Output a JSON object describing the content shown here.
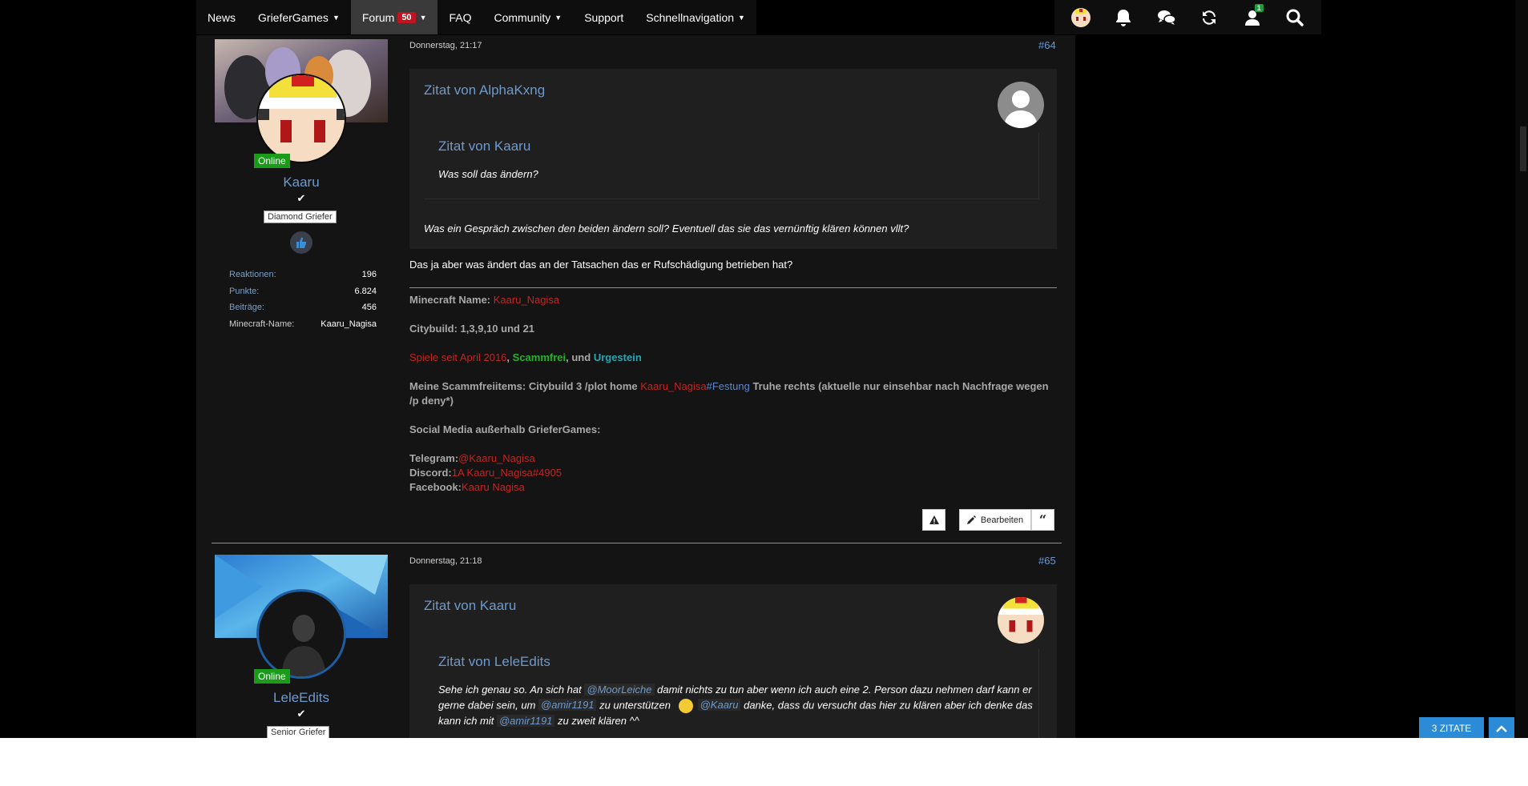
{
  "nav": {
    "items": [
      {
        "label": "News"
      },
      {
        "label": "GrieferGames"
      },
      {
        "label": "Forum",
        "badge": "50"
      },
      {
        "label": "FAQ"
      },
      {
        "label": "Community"
      },
      {
        "label": "Support"
      },
      {
        "label": "Schnellnavigation"
      }
    ],
    "icons": [
      "user-avatar-icon",
      "bell-icon",
      "chat-icon",
      "refresh-icon",
      "user-icon",
      "search-icon"
    ],
    "user_badge": "1"
  },
  "posts": [
    {
      "date": "Donnerstag, 21:17",
      "number": "#64",
      "user": {
        "status": "Online",
        "name": "Kaaru",
        "rank": "Diamond Griefer",
        "stats": [
          {
            "label": "Reaktionen:",
            "value": "196"
          },
          {
            "label": "Punkte:",
            "value": "6.824"
          },
          {
            "label": "Beiträge:",
            "value": "456"
          },
          {
            "label": "Minecraft-Name:",
            "value": "Kaaru_Nagisa"
          }
        ]
      },
      "quote": {
        "header": "Zitat von AlphaKxng",
        "inner_header": "Zitat von Kaaru",
        "inner_text": "Was soll das ändern?",
        "text": "Was ein Gespräch zwischen den beiden ändern soll? Eventuell das sie das vernünftig klären können vllt?"
      },
      "body": "Das ja aber was ändert das an der Tatsachen das er Rufschädigung betrieben hat?",
      "signature": {
        "mc_label": "Minecraft Name: ",
        "mc_value": "Kaaru_Nagisa",
        "citybuild": "Citybuild: 1,3,9,10 und 21",
        "since": "Spiele seit April 2016",
        "comma": ", ",
        "scammfrei": "Scammfrei",
        "und": ", und ",
        "urgestein": "Urgestein",
        "items_prefix": "Meine Scammfreiitems: Citybuild 3 /plot home ",
        "items_name": "Kaaru_Nagisa",
        "items_hash": "#Festung",
        "items_suffix": " Truhe rechts (aktuelle nur einsehbar nach Nachfrage wegen /p deny*)",
        "social": "Social Media außerhalb GrieferGames:",
        "telegram_label": "Telegram:",
        "telegram_value": "@Kaaru_Nagisa",
        "discord_label": "Discord:",
        "discord_value": "1A Kaaru_Nagisa#4905",
        "facebook_label": "Facebook:",
        "facebook_value": "Kaaru Nagisa"
      },
      "actions": {
        "edit": "Bearbeiten"
      }
    },
    {
      "date": "Donnerstag, 21:18",
      "number": "#65",
      "user": {
        "status": "Online",
        "name": "LeleEdits",
        "rank": "Senior Griefer"
      },
      "quote": {
        "header": "Zitat von Kaaru",
        "inner_header": "Zitat von LeleEdits",
        "line1_a": "Sehe ich genau so. An sich hat ",
        "mention1": "@MoorLeiche",
        "line1_b": " damit nichts zu tun aber wenn ich auch eine 2. Person dazu nehmen darf kann er",
        "line2_a": "gerne dabei sein, um ",
        "mention2": "@amir1191",
        "line2_b": " zu unterstützen ",
        "mention3": "@Kaaru",
        "line2_c": " danke, dass du versucht das hier zu klären aber ich denke das",
        "line3_a": "kann ich mit ",
        "mention4": "@amir1191",
        "line3_b": " zu zweit klären ^^"
      }
    }
  ],
  "floating": {
    "quotes_button": "3 ZITATE"
  },
  "colors": {
    "accent": "#6e9acd",
    "badge_red": "#c1121f",
    "online_green": "#1a9b1a",
    "floating_blue": "#2b8bd6"
  }
}
